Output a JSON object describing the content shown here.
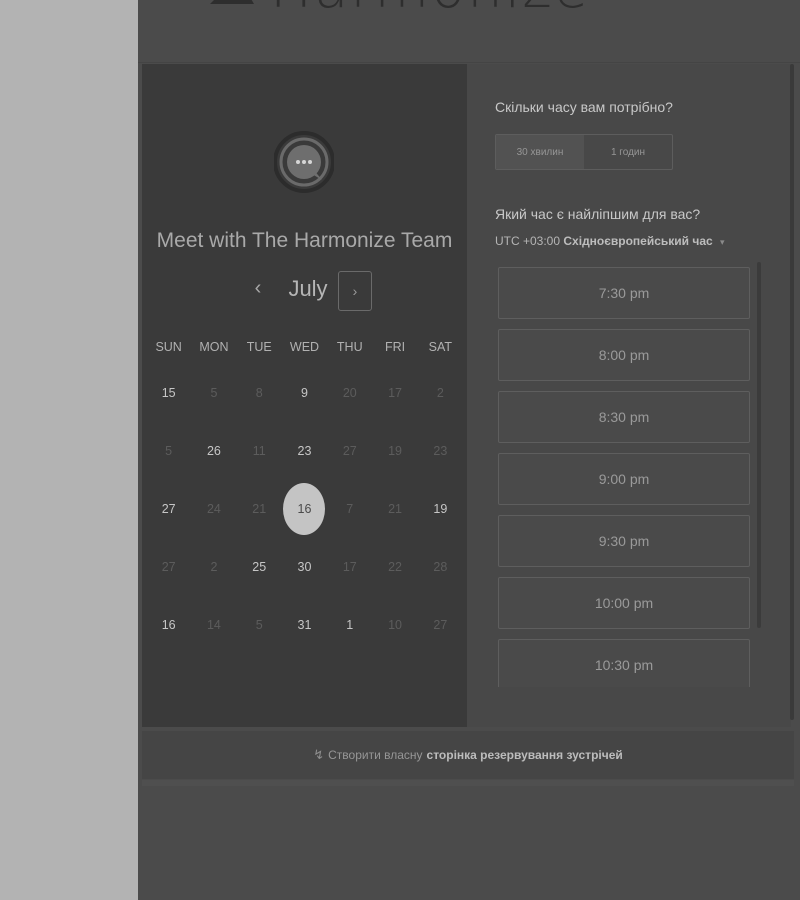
{
  "header": {
    "brand": "Harmonize"
  },
  "calendar": {
    "title": "Meet with The Harmonize Team",
    "month": "July",
    "prev_icon": "‹",
    "next_icon": "›",
    "weekdays": [
      "SUN",
      "MON",
      "TUE",
      "WED",
      "THU",
      "FRI",
      "SAT"
    ],
    "days": [
      {
        "d": "15",
        "avail": true
      },
      {
        "d": "5",
        "avail": false
      },
      {
        "d": "8",
        "avail": false
      },
      {
        "d": "9",
        "avail": true
      },
      {
        "d": "20",
        "avail": false
      },
      {
        "d": "17",
        "avail": false
      },
      {
        "d": "2",
        "avail": false
      },
      {
        "d": "5",
        "avail": false
      },
      {
        "d": "26",
        "avail": true
      },
      {
        "d": "11",
        "avail": false
      },
      {
        "d": "23",
        "avail": true
      },
      {
        "d": "27",
        "avail": false
      },
      {
        "d": "19",
        "avail": false
      },
      {
        "d": "23",
        "avail": false
      },
      {
        "d": "27",
        "avail": true
      },
      {
        "d": "24",
        "avail": false
      },
      {
        "d": "21",
        "avail": false
      },
      {
        "d": "16",
        "avail": true,
        "selected": true
      },
      {
        "d": "7",
        "avail": false
      },
      {
        "d": "21",
        "avail": false
      },
      {
        "d": "19",
        "avail": true
      },
      {
        "d": "27",
        "avail": false
      },
      {
        "d": "2",
        "avail": false
      },
      {
        "d": "25",
        "avail": true
      },
      {
        "d": "30",
        "avail": true
      },
      {
        "d": "17",
        "avail": false
      },
      {
        "d": "22",
        "avail": false
      },
      {
        "d": "28",
        "avail": false
      },
      {
        "d": "16",
        "avail": true
      },
      {
        "d": "14",
        "avail": false
      },
      {
        "d": "5",
        "avail": false
      },
      {
        "d": "31",
        "avail": true
      },
      {
        "d": "1",
        "avail": true
      },
      {
        "d": "10",
        "avail": false
      },
      {
        "d": "27",
        "avail": false
      }
    ]
  },
  "booking": {
    "duration_question": "Скільки часу вам потрібно?",
    "durations": [
      {
        "label": "30 хвилин",
        "active": true
      },
      {
        "label": "1 годин",
        "active": false
      }
    ],
    "time_question": "Який час є найліпшим для вас?",
    "timezone_prefix": "UTC +03:00",
    "timezone_name": "Східноєвропейський час",
    "timezone_caret": "▾",
    "slots": [
      "7:30 pm",
      "8:00 pm",
      "8:30 pm",
      "9:00 pm",
      "9:30 pm",
      "10:00 pm",
      "10:30 pm"
    ]
  },
  "footer": {
    "icon": "↯",
    "prefix": "Створити власну",
    "link": "сторінка резервування зустрічей"
  },
  "colors": {
    "background": "#4b4b4b",
    "side": "#b3b3b3",
    "panel": "#3a3a3a",
    "selected_day": "#c4c4c4"
  }
}
